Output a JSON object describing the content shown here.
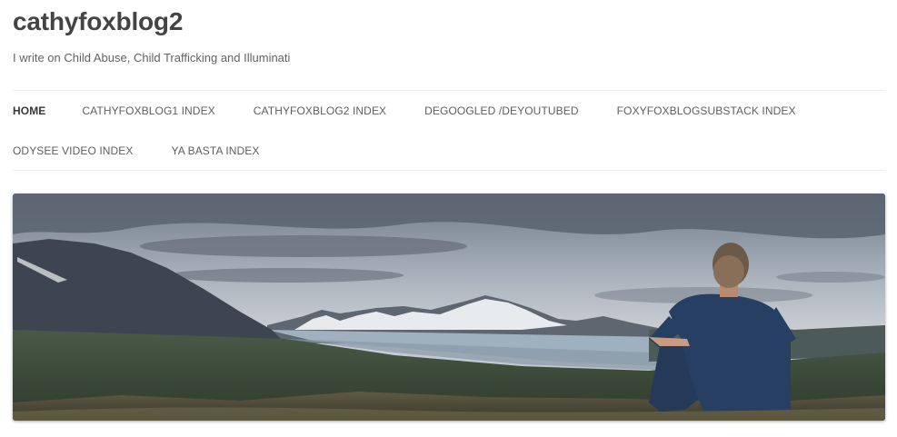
{
  "site": {
    "title": "cathyfoxblog2",
    "description": "I write on Child Abuse, Child Trafficking and Illuminati"
  },
  "nav": {
    "row1": [
      {
        "label": "HOME",
        "current": true
      },
      {
        "label": "CATHYFOXBLOG1 INDEX"
      },
      {
        "label": "CATHYFOXBLOG2 INDEX"
      },
      {
        "label": "DEGOOGLED /DEYOUTUBED"
      },
      {
        "label": "FOXYFOXBLOGSUBSTACK INDEX"
      }
    ],
    "row2": [
      {
        "label": "ODYSEE VIDEO INDEX"
      },
      {
        "label": "YA BASTA INDEX"
      }
    ]
  },
  "banner": {
    "scene": "man-sitting-overlooking-mountains-and-glacier"
  },
  "colors": {
    "title": "#444444",
    "nav_text": "#5e5e5e",
    "divider": "#ededed"
  }
}
